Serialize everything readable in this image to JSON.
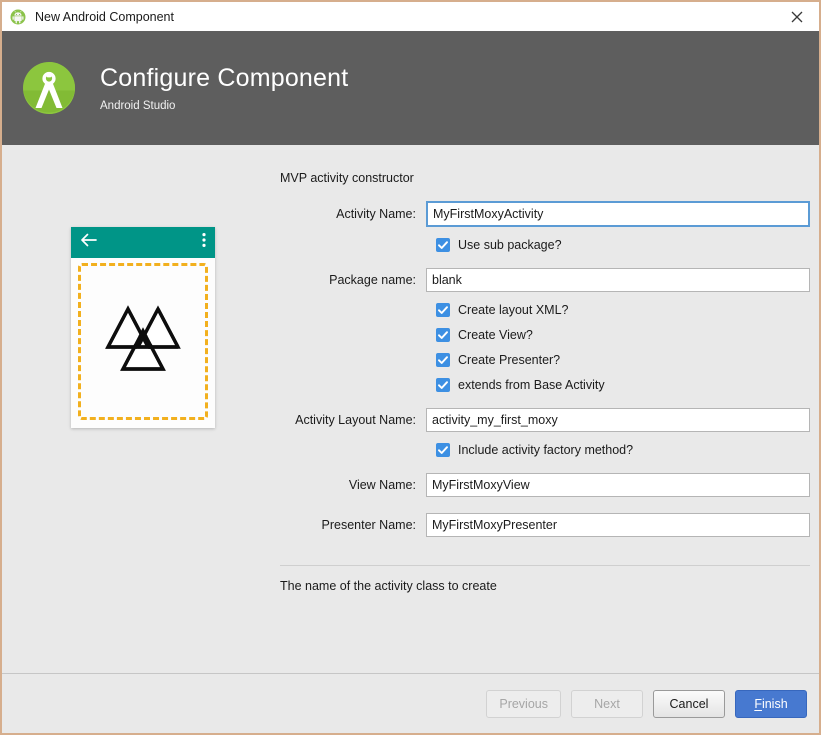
{
  "window": {
    "title": "New Android Component",
    "title_icon": "android-robot-icon",
    "close_icon": "close-icon",
    "border_color": "#d6ae8d"
  },
  "header": {
    "logo_icon": "android-studio-logo-icon",
    "title": "Configure Component",
    "subtitle": "Android Studio",
    "background_color": "#5e5e5e"
  },
  "preview": {
    "toolbar_color": "#009587",
    "back_icon": "back-arrow-icon",
    "overflow_icon": "overflow-menu-icon",
    "dashed_border_color": "#f2b01e",
    "content_icon": "valknut-triangles-icon"
  },
  "form": {
    "section_title": "MVP activity constructor",
    "fields": [
      {
        "label": "Activity Name:",
        "value": "MyFirstMoxyActivity",
        "focused": true
      },
      {
        "label": "Package name:",
        "value": "blank",
        "focused": false
      },
      {
        "label": "Activity Layout Name:",
        "value": "activity_my_first_moxy",
        "focused": false
      },
      {
        "label": "View Name:",
        "value": "MyFirstMoxyView",
        "focused": false
      },
      {
        "label": "Presenter Name:",
        "value": "MyFirstMoxyPresenter",
        "focused": false
      }
    ],
    "checkboxes": [
      {
        "label": "Use sub package?",
        "checked": true
      },
      {
        "label": "Create layout XML?",
        "checked": true
      },
      {
        "label": "Create View?",
        "checked": true
      },
      {
        "label": "Create Presenter?",
        "checked": true
      },
      {
        "label": "extends from Base Activity",
        "checked": true
      },
      {
        "label": "Include activity factory method?",
        "checked": true
      }
    ],
    "checkbox_color": "#3d90e3",
    "hint": "The name of the activity class to create"
  },
  "footer": {
    "buttons": [
      {
        "label": "Previous",
        "state": "disabled"
      },
      {
        "label": "Next",
        "state": "disabled"
      },
      {
        "label": "Cancel",
        "state": "normal"
      },
      {
        "label": "Finish",
        "state": "default",
        "mnemonic": "F",
        "rest": "inish"
      }
    ],
    "default_button_color": "#4779d0"
  }
}
